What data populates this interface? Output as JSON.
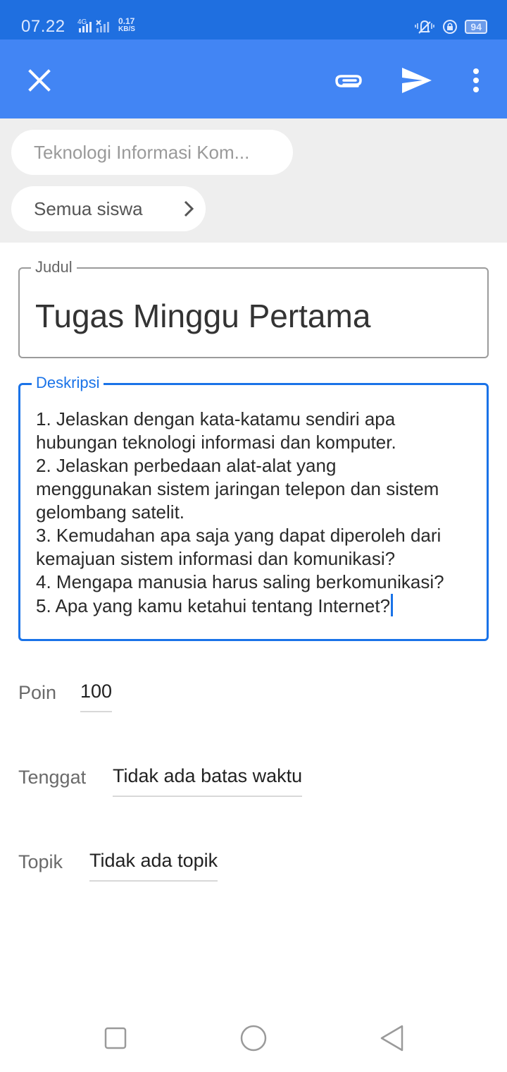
{
  "status_bar": {
    "time": "07.22",
    "network": "4G",
    "speed_value": "0.17",
    "speed_unit": "KB/S",
    "battery": "94"
  },
  "app_bar": {
    "icons": [
      "close-icon",
      "paperclip-icon",
      "send-icon",
      "more-vertical-icon"
    ],
    "color": "#4285f4"
  },
  "chips": {
    "class_name": "Teknologi Informasi Kom...",
    "students": "Semua siswa"
  },
  "title_field": {
    "label": "Judul",
    "value": "Tugas Minggu Pertama"
  },
  "description_field": {
    "label": "Deskripsi",
    "lines": [
      "1. Jelaskan dengan kata-katamu sendiri apa",
      "hubungan teknologi informasi dan komputer.",
      "2. Jelaskan perbedaan alat-alat yang",
      "menggunakan sistem jaringan telepon dan sistem",
      "gelombang satelit.",
      "3. Kemudahan apa saja yang dapat diperoleh dari",
      "kemajuan sistem informasi dan komunikasi?",
      "4. Mengapa manusia harus saling berkomunikasi?",
      "5. Apa yang kamu ketahui tentang Internet?"
    ],
    "accent": "#1a73e8"
  },
  "points": {
    "label": "Poin",
    "value": "100"
  },
  "due": {
    "label": "Tenggat",
    "value": "Tidak ada batas waktu"
  },
  "topic": {
    "label": "Topik",
    "value": "Tidak ada topik"
  },
  "nav_bar": {
    "icons": [
      "recents-square-icon",
      "home-circle-icon",
      "back-triangle-icon"
    ]
  }
}
